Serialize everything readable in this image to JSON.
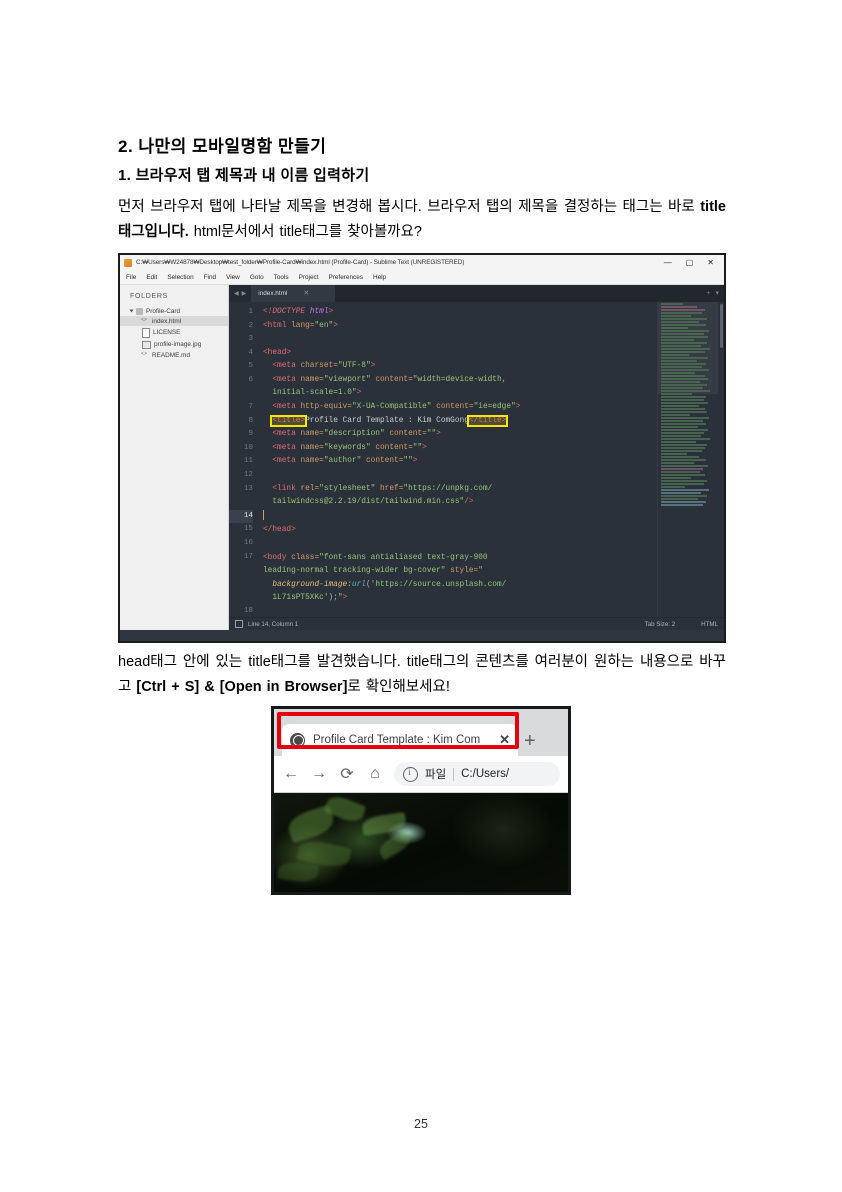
{
  "document": {
    "heading_main": "2.  나만의  모바일명함  만들기",
    "heading_sub": "1. 브라우저 탭 제목과 내 이름 입력하기",
    "paragraph1_a": "먼저 브라우저 탭에 나타날 제목을 변경해 봅시다. 브라우저 탭의 제목을 결정하는 태그는 바로 ",
    "paragraph1_b": "title태그입니다.",
    "paragraph1_c": " html문서에서 title태그를 찾아볼까요?",
    "paragraph2_a": "head태그 안에 있는 title태그를 발견했습니다. title태그의 콘텐츠를 여러분이 원하는 내용으로 바꾸고 ",
    "paragraph2_b": "[Ctrl + S] & [Open in Browser]",
    "paragraph2_c": "로 확인해보세요!",
    "page_number": "25"
  },
  "sublime": {
    "titlebar": {
      "text": "C:₩Users₩W24878₩Desktop₩test_folder₩Profile-Card₩index.html (Profile-Card) - Sublime Text (UNREGISTERED)",
      "minimize": "—",
      "maximize": "▢",
      "close": "✕"
    },
    "menu": [
      "File",
      "Edit",
      "Selection",
      "Find",
      "View",
      "Goto",
      "Tools",
      "Project",
      "Preferences",
      "Help"
    ],
    "sidebar": {
      "label": "FOLDERS",
      "root": "Profile-Card",
      "files": [
        {
          "name": "index.html",
          "icon": "code-file-icon",
          "selected": true
        },
        {
          "name": "LICENSE",
          "icon": "plain-file-icon",
          "selected": false
        },
        {
          "name": "profile-image.jpg",
          "icon": "image-file-icon",
          "selected": false
        },
        {
          "name": "README.md",
          "icon": "code-file-icon",
          "selected": false
        }
      ]
    },
    "tab": {
      "name": "index.html",
      "close": "✕",
      "prev": "◀",
      "next": "▶",
      "add": "+",
      "dropdown": "▾"
    },
    "statusbar": {
      "position": "Line 14, Column 1",
      "tab_size": "Tab Size: 2",
      "syntax": "HTML"
    },
    "code_lines": [
      {
        "n": "1",
        "text": "<!DOCTYPE html>"
      },
      {
        "n": "2",
        "text": "<html lang=\"en\">"
      },
      {
        "n": "3",
        "text": ""
      },
      {
        "n": "4",
        "text": "<head>"
      },
      {
        "n": "5",
        "text": "  <meta charset=\"UTF-8\">"
      },
      {
        "n": "6",
        "text": "  <meta name=\"viewport\" content=\"width=device-width, initial-scale=1.0\">"
      },
      {
        "n": "7",
        "text": "  <meta http-equiv=\"X-UA-Compatible\" content=\"ie=edge\">"
      },
      {
        "n": "8",
        "text": "  <title>Profile Card Template : Kim ComGong</title>"
      },
      {
        "n": "9",
        "text": "  <meta name=\"description\" content=\"\">"
      },
      {
        "n": "10",
        "text": "  <meta name=\"keywords\" content=\"\">"
      },
      {
        "n": "11",
        "text": "  <meta name=\"author\" content=\"\">"
      },
      {
        "n": "12",
        "text": ""
      },
      {
        "n": "13",
        "text": "  <link rel=\"stylesheet\" href=\"https://unpkg.com/tailwindcss@2.2.19/dist/tailwind.min.css\"/>"
      },
      {
        "n": "14",
        "text": "",
        "current": true
      },
      {
        "n": "15",
        "text": "</head>"
      },
      {
        "n": "16",
        "text": ""
      },
      {
        "n": "17",
        "text": "<body class=\"font-sans antialiased text-gray-900 leading-normal tracking-wider bg-cover\" style=\"background-image:url('https://source.unsplash.com/1L71sPT5XKc');\">"
      },
      {
        "n": "18",
        "text": ""
      }
    ],
    "code_tokens": {
      "l1_open": "<!DOCTYPE",
      "l1_val": "html",
      "l1_close": ">",
      "l2_tag": "<html",
      "l2_attr": " lang=",
      "l2_str": "\"en\"",
      "l2_close": ">",
      "l4_head": "<head>",
      "l5_tag": "<meta",
      "l5_attr": " charset=",
      "l5_str": "\"UTF-8\"",
      "l5_close": ">",
      "l6_tag": "<meta",
      "l6_attr1": " name=",
      "l6_str1": "\"viewport\"",
      "l6_attr2": " content=",
      "l6_str2a": "\"width=device-width,",
      "l6_str2b": "initial-scale=1.0\"",
      "l6_close": ">",
      "l7_tag": "<meta",
      "l7_attr1": " http-equiv=",
      "l7_str1": "\"X-UA-Compatible\"",
      "l7_attr2": " content=",
      "l7_str2": "\"ie=edge\"",
      "l7_close": ">",
      "l8_open": "<title>",
      "l8_text": "Profile Card Template : Kim ComGong",
      "l8_close": "</title>",
      "l9_tag": "<meta",
      "l9_attr1": " name=",
      "l9_str1": "\"description\"",
      "l9_attr2": " content=",
      "l9_str2": "\"\"",
      "l9_close": ">",
      "l10_tag": "<meta",
      "l10_attr1": " name=",
      "l10_str1": "\"keywords\"",
      "l10_attr2": " content=",
      "l10_str2": "\"\"",
      "l10_close": ">",
      "l11_tag": "<meta",
      "l11_attr1": " name=",
      "l11_str1": "\"author\"",
      "l11_attr2": " content=",
      "l11_str2": "\"\"",
      "l11_close": ">",
      "l13_tag": "<link",
      "l13_attr1": " rel=",
      "l13_str1": "\"stylesheet\"",
      "l13_attr2": " href=",
      "l13_str2a": "\"https://unpkg.com/",
      "l13_str2b": "tailwindcss@2.2.19/dist/tailwind.min.css\"",
      "l13_close": "/>",
      "l15_head": "</head>",
      "l17_tag": "<body",
      "l17_attr1": " class=",
      "l17_str1a": "\"font-sans antialiased text-gray-900",
      "l17_str1b": "leading-normal tracking-wider bg-cover\"",
      "l17_attr2": " style=",
      "l17_str2a": "\"",
      "l17_prop": "background-image:",
      "l17_url": "url",
      "l17_p1": "(",
      "l17_str3a": "'https://source.unsplash.com/",
      "l17_str3b": "1L71sPT5XKc'",
      "l17_p2": ");",
      "l17_q": "\"",
      "l17_close": ">"
    }
  },
  "browser": {
    "tab_title": "Profile Card Template : Kim Com",
    "tab_close": "✕",
    "new_tab": "+",
    "back": "←",
    "forward": "→",
    "reload": "⟳",
    "home": "⌂",
    "security_label": "파일",
    "url": "C:/Users/"
  },
  "colors": {
    "highlight_yellow": "#f7e600",
    "highlight_red": "#e3000f",
    "editor_bg": "#2b313a",
    "tag_red": "#e06c75",
    "string_green": "#98c379",
    "attr_orange": "#d19a66"
  }
}
